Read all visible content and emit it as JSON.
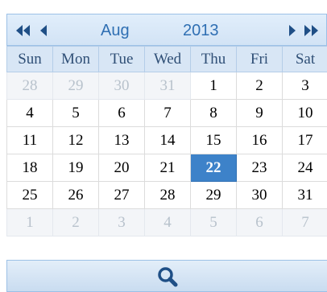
{
  "header": {
    "month": "Aug",
    "year": "2013",
    "icons": [
      "prev-year-icon",
      "prev-month-icon",
      "next-month-icon",
      "next-year-icon"
    ]
  },
  "weekdays": [
    "Sun",
    "Mon",
    "Tue",
    "Wed",
    "Thu",
    "Fri",
    "Sat"
  ],
  "weeks": [
    [
      {
        "d": "28",
        "other": true
      },
      {
        "d": "29",
        "other": true
      },
      {
        "d": "30",
        "other": true
      },
      {
        "d": "31",
        "other": true
      },
      {
        "d": "1"
      },
      {
        "d": "2"
      },
      {
        "d": "3"
      }
    ],
    [
      {
        "d": "4"
      },
      {
        "d": "5"
      },
      {
        "d": "6"
      },
      {
        "d": "7"
      },
      {
        "d": "8"
      },
      {
        "d": "9"
      },
      {
        "d": "10"
      }
    ],
    [
      {
        "d": "11"
      },
      {
        "d": "12"
      },
      {
        "d": "13"
      },
      {
        "d": "14"
      },
      {
        "d": "15"
      },
      {
        "d": "16"
      },
      {
        "d": "17"
      }
    ],
    [
      {
        "d": "18"
      },
      {
        "d": "19"
      },
      {
        "d": "20"
      },
      {
        "d": "21"
      },
      {
        "d": "22",
        "selected": true
      },
      {
        "d": "23"
      },
      {
        "d": "24"
      }
    ],
    [
      {
        "d": "25"
      },
      {
        "d": "26"
      },
      {
        "d": "27"
      },
      {
        "d": "28"
      },
      {
        "d": "29"
      },
      {
        "d": "30"
      },
      {
        "d": "31"
      }
    ],
    [
      {
        "d": "1",
        "other": true
      },
      {
        "d": "2",
        "other": true
      },
      {
        "d": "3",
        "other": true
      },
      {
        "d": "4",
        "other": true
      },
      {
        "d": "5",
        "other": true
      },
      {
        "d": "6",
        "other": true
      },
      {
        "d": "7",
        "other": true
      }
    ]
  ],
  "footer": {
    "icon": "search-icon"
  },
  "colors": {
    "accent": "#3d82c9",
    "header_text": "#2f6fb3",
    "other_month_text": "#b8c2cc"
  }
}
